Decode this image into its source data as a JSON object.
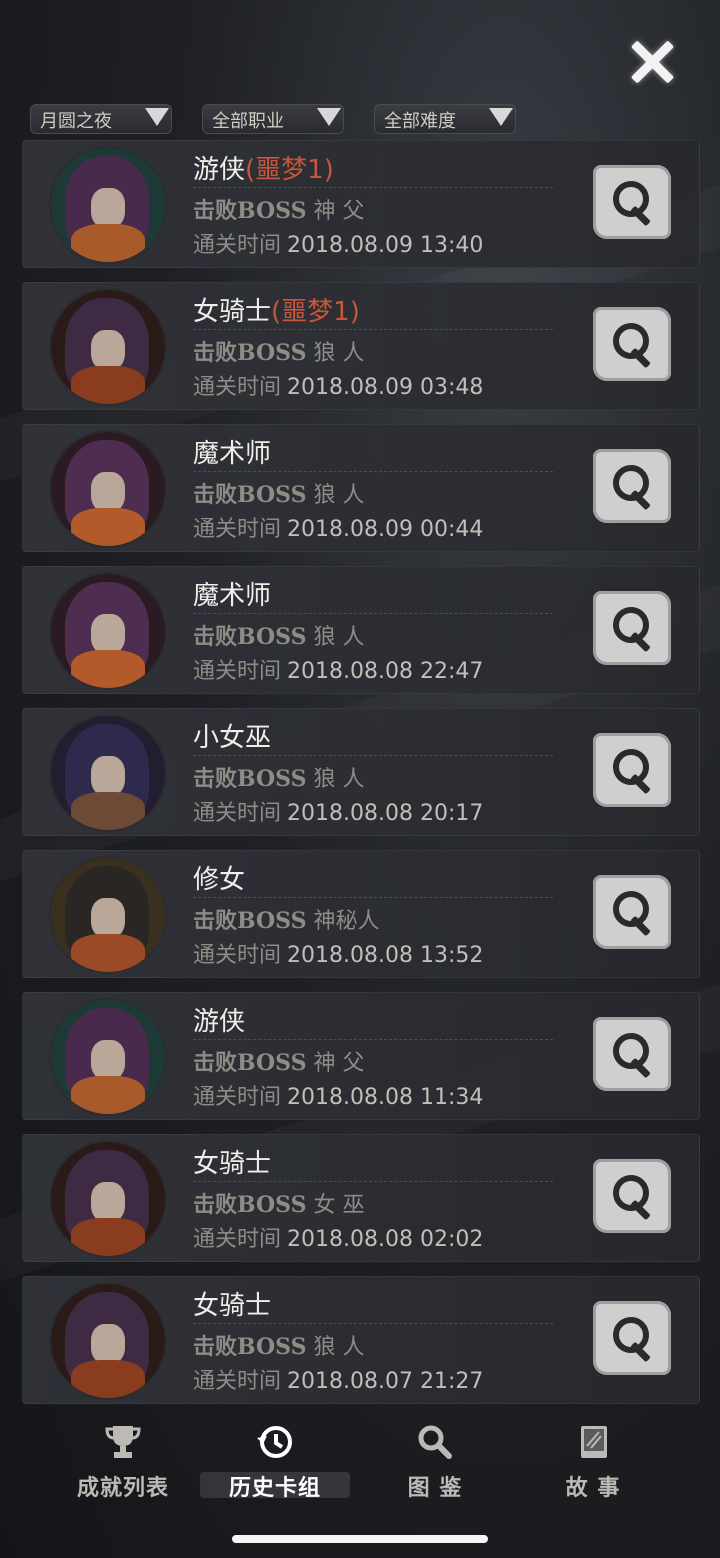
{
  "filters": [
    {
      "label": "月圆之夜"
    },
    {
      "label": "全部职业"
    },
    {
      "label": "全部难度"
    }
  ],
  "boss_prefix": "击败BOSS",
  "time_prefix": "通关时间",
  "entries": [
    {
      "name": "游侠",
      "difficulty": "(噩梦1)",
      "boss": "神 父",
      "time": "2018.08.09 13:40",
      "avatar": "ranger"
    },
    {
      "name": "女骑士",
      "difficulty": "(噩梦1)",
      "boss": "狼 人",
      "time": "2018.08.09 03:48",
      "avatar": "knight"
    },
    {
      "name": "魔术师",
      "difficulty": "",
      "boss": "狼 人",
      "time": "2018.08.09 00:44",
      "avatar": "magician"
    },
    {
      "name": "魔术师",
      "difficulty": "",
      "boss": "狼 人",
      "time": "2018.08.08 22:47",
      "avatar": "magician"
    },
    {
      "name": "小女巫",
      "difficulty": "",
      "boss": "狼 人",
      "time": "2018.08.08 20:17",
      "avatar": "witch"
    },
    {
      "name": "修女",
      "difficulty": "",
      "boss": "神秘人",
      "time": "2018.08.08 13:52",
      "avatar": "nun"
    },
    {
      "name": "游侠",
      "difficulty": "",
      "boss": "神 父",
      "time": "2018.08.08 11:34",
      "avatar": "ranger"
    },
    {
      "name": "女骑士",
      "difficulty": "",
      "boss": "女 巫",
      "time": "2018.08.08 02:02",
      "avatar": "knight"
    },
    {
      "name": "女骑士",
      "difficulty": "",
      "boss": "狼 人",
      "time": "2018.08.07 21:27",
      "avatar": "knight"
    }
  ],
  "tabs": [
    {
      "label": "成就列表",
      "icon": "trophy-icon",
      "active": false
    },
    {
      "label": "历史卡组",
      "icon": "history-icon",
      "active": true
    },
    {
      "label": "图 鉴",
      "icon": "magnifier-icon",
      "active": false
    },
    {
      "label": "故 事",
      "icon": "book-icon",
      "active": false
    }
  ],
  "colors": {
    "difficulty": "#c9553a",
    "accent": "#ffffff"
  }
}
